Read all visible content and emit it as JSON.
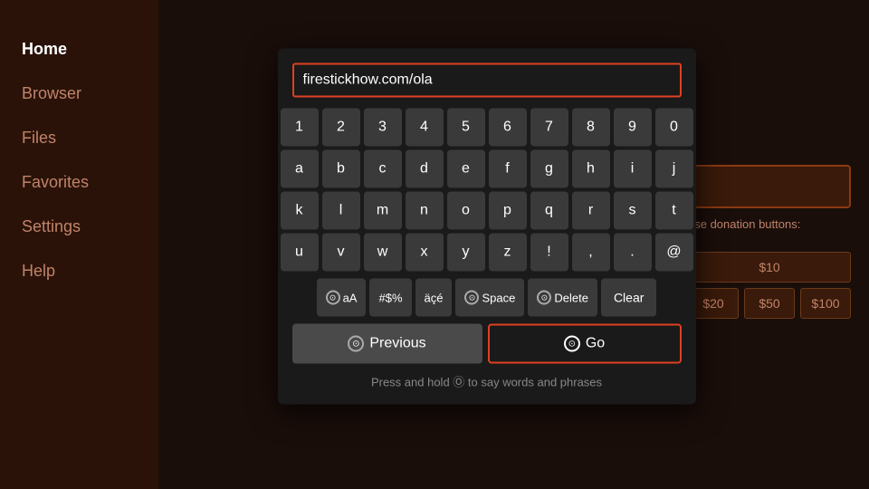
{
  "sidebar": {
    "items": [
      {
        "label": "Home",
        "active": true
      },
      {
        "label": "Browser",
        "active": false
      },
      {
        "label": "Files",
        "active": false
      },
      {
        "label": "Favorites",
        "active": false
      },
      {
        "label": "Settings",
        "active": false
      },
      {
        "label": "Help",
        "active": false
      }
    ]
  },
  "keyboard": {
    "url_value": "firestickhow.com/ola",
    "url_placeholder": "firestickhow.com/ola",
    "rows": {
      "numbers": [
        "1",
        "2",
        "3",
        "4",
        "5",
        "6",
        "7",
        "8",
        "9",
        "0"
      ],
      "row1": [
        "a",
        "b",
        "c",
        "d",
        "e",
        "f",
        "g",
        "h",
        "i",
        "j"
      ],
      "row2": [
        "k",
        "l",
        "m",
        "n",
        "o",
        "p",
        "q",
        "r",
        "s",
        "t"
      ],
      "row3": [
        "u",
        "v",
        "w",
        "x",
        "y",
        "z",
        "!",
        ",",
        ".",
        "@"
      ]
    },
    "special_buttons": {
      "caps": "aA",
      "symbols": "#$%",
      "accents": "äçé",
      "space": "Space",
      "delete": "Delete",
      "clear": "Clear"
    },
    "action_buttons": {
      "previous": "Previous",
      "go": "Go"
    },
    "hint": "Press and hold Ⓞ to say words and phrases"
  },
  "right_panel": {
    "donation_text": "ase donation buttons:",
    "donation_suffix": ")",
    "amounts_row1": [
      "$10"
    ],
    "amounts_row2": [
      "$20",
      "$50",
      "$100"
    ]
  }
}
